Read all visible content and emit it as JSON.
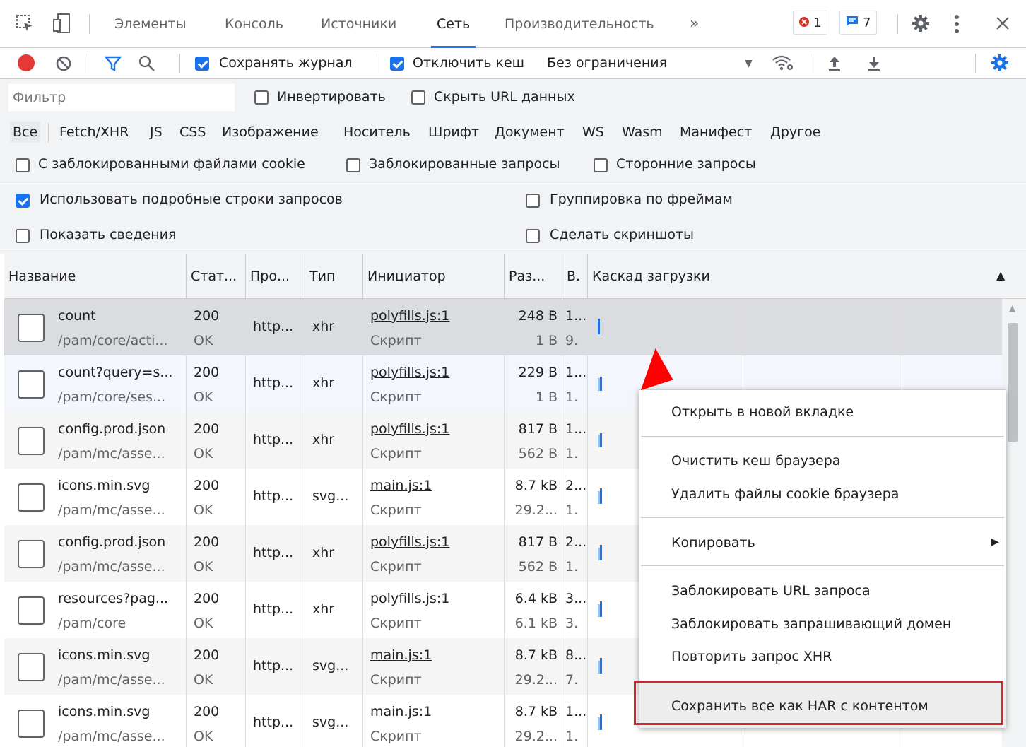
{
  "tabs": {
    "elements": "Элементы",
    "console": "Консоль",
    "sources": "Источники",
    "network": "Сеть",
    "performance": "Производительность",
    "more": "»",
    "error_count": "1",
    "message_count": "7"
  },
  "toolbar": {
    "preserve_log": "Сохранять журнал",
    "disable_cache": "Отключить кеш",
    "throttling": "Без ограничения"
  },
  "filter": {
    "placeholder": "Фильтр",
    "invert": "Инвертировать",
    "hide_data_urls": "Скрыть URL данных"
  },
  "types": [
    "Все",
    "Fetch/XHR",
    "JS",
    "CSS",
    "Изображение",
    "Носитель",
    "Шрифт",
    "Документ",
    "WS",
    "Wasm",
    "Манифест",
    "Другое"
  ],
  "cookies": {
    "blocked_cookies": "С заблокированными файлами cookie",
    "blocked_requests": "Заблокированные запросы",
    "third_party": "Сторонние запросы"
  },
  "settings": {
    "big_rows": "Использовать подробные строки запросов",
    "group_by_frame": "Группировка по фреймам",
    "show_overview": "Показать сведения",
    "capture_screenshots": "Сделать скриншоты"
  },
  "columns": {
    "name": "Название",
    "status": "Стат...",
    "protocol": "Про...",
    "type": "Тип",
    "initiator": "Инициатор",
    "size": "Раз...",
    "time": "В.",
    "waterfall": "Каскад загрузки"
  },
  "rows": [
    {
      "name": "count",
      "path": "/pam/core/acti...",
      "status": "200",
      "status_text": "OK",
      "protocol": "http...",
      "type": "xhr",
      "initiator": "polyfills.js:1",
      "initiator_type": "Скрипт",
      "size1": "248 B",
      "size2": "1 B",
      "time1": "1...",
      "time2": "9."
    },
    {
      "name": "count?query=s...",
      "path": "/pam/core/ses...",
      "status": "200",
      "status_text": "OK",
      "protocol": "http...",
      "type": "xhr",
      "initiator": "polyfills.js:1",
      "initiator_type": "Скрипт",
      "size1": "229 B",
      "size2": "1 B",
      "time1": "1...",
      "time2": "1."
    },
    {
      "name": "config.prod.json",
      "path": "/pam/mc/asse...",
      "status": "200",
      "status_text": "OK",
      "protocol": "http...",
      "type": "xhr",
      "initiator": "polyfills.js:1",
      "initiator_type": "Скрипт",
      "size1": "817 B",
      "size2": "562 B",
      "time1": "1...",
      "time2": "1."
    },
    {
      "name": "icons.min.svg",
      "path": "/pam/mc/asse...",
      "status": "200",
      "status_text": "OK",
      "protocol": "http...",
      "type": "svg...",
      "initiator": "main.js:1",
      "initiator_type": "Скрипт",
      "size1": "8.7 kB",
      "size2": "29.2...",
      "time1": "2...",
      "time2": "1."
    },
    {
      "name": "config.prod.json",
      "path": "/pam/mc/asse...",
      "status": "200",
      "status_text": "OK",
      "protocol": "http...",
      "type": "xhr",
      "initiator": "polyfills.js:1",
      "initiator_type": "Скрипт",
      "size1": "817 B",
      "size2": "562 B",
      "time1": "2...",
      "time2": "1."
    },
    {
      "name": "resources?pag...",
      "path": "/pam/core",
      "status": "200",
      "status_text": "OK",
      "protocol": "http...",
      "type": "xhr",
      "initiator": "polyfills.js:1",
      "initiator_type": "Скрипт",
      "size1": "6.4 kB",
      "size2": "6.1 kB",
      "time1": "3...",
      "time2": "3."
    },
    {
      "name": "icons.min.svg",
      "path": "/pam/mc/asse...",
      "status": "200",
      "status_text": "OK",
      "protocol": "http...",
      "type": "svg...",
      "initiator": "main.js:1",
      "initiator_type": "Скрипт",
      "size1": "8.7 kB",
      "size2": "29.2...",
      "time1": "8...",
      "time2": "7."
    },
    {
      "name": "icons.min.svg",
      "path": "/pam/mc/asse...",
      "status": "200",
      "status_text": "OK",
      "protocol": "http...",
      "type": "svg...",
      "initiator": "main.js:1",
      "initiator_type": "Скрипт",
      "size1": "8.7 kB",
      "size2": "29.2...",
      "time1": "1...",
      "time2": "1."
    }
  ],
  "menu": {
    "open_new_tab": "Открыть в новой вкладке",
    "clear_cache": "Очистить кеш браузера",
    "clear_cookies": "Удалить файлы cookie браузера",
    "copy": "Копировать",
    "block_url": "Заблокировать URL запроса",
    "block_domain": "Заблокировать запрашивающий домен",
    "replay_xhr": "Повторить запрос XHR",
    "save_har": "Сохранить все как HAR с контентом"
  },
  "colors": {
    "accent": "#1a73e8",
    "record": "#e53935",
    "highlight_border": "#d9232e",
    "annotation_arrow": "#ff0000"
  }
}
